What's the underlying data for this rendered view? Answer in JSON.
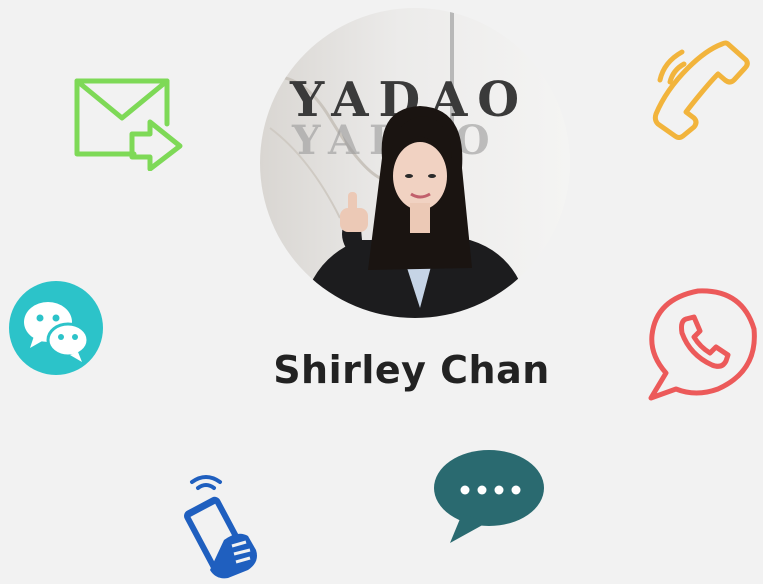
{
  "profile": {
    "name": "Shirley Chan",
    "wall_logo_text": "YADAO"
  },
  "contact_icons": [
    {
      "icon": "email-send-icon",
      "color": "#7ed957"
    },
    {
      "icon": "phone-icon",
      "color": "#f2b43c"
    },
    {
      "icon": "wechat-icon",
      "color": "#2cc3c9"
    },
    {
      "icon": "whatsapp-icon",
      "color": "#ec5a5a"
    },
    {
      "icon": "mobile-call-icon",
      "color": "#1f5fbf"
    },
    {
      "icon": "chat-bubble-icon",
      "color": "#2a6a70"
    }
  ]
}
